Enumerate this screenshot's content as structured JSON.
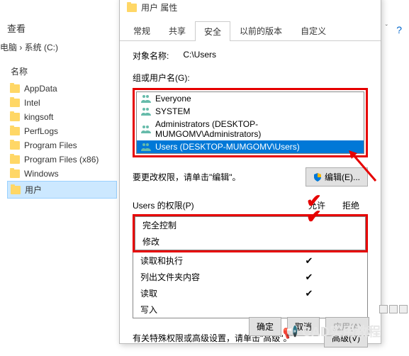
{
  "explorer": {
    "view_label": "查看",
    "breadcrumb": "电脑 › 系统 (C:)",
    "names_header": "名称",
    "folders": [
      "AppData",
      "Intel",
      "kingsoft",
      "PerfLogs",
      "Program Files",
      "Program Files (x86)",
      "Windows",
      "用户"
    ]
  },
  "dialog": {
    "title": "用户 属性",
    "tabs": [
      "常规",
      "共享",
      "安全",
      "以前的版本",
      "自定义"
    ],
    "object_label": "对象名称:",
    "object_value": "C:\\Users",
    "group_label": "组或用户名(G):",
    "groups": [
      {
        "name": "Everyone"
      },
      {
        "name": "SYSTEM"
      },
      {
        "name": "Administrators (DESKTOP-MUMGOMV\\Administrators)"
      },
      {
        "name": "Users (DESKTOP-MUMGOMV\\Users)"
      }
    ],
    "edit_hint": "要更改权限，请单击\"编辑\"。",
    "edit_btn": "编辑(E)...",
    "perm_header": "Users 的权限(P)",
    "allow": "允许",
    "deny": "拒绝",
    "perms": [
      {
        "name": "完全控制",
        "allow": false
      },
      {
        "name": "修改",
        "allow": false
      },
      {
        "name": "读取和执行",
        "allow": true
      },
      {
        "name": "列出文件夹内容",
        "allow": true
      },
      {
        "name": "读取",
        "allow": true
      },
      {
        "name": "写入",
        "allow": false
      }
    ],
    "adv_hint": "有关特殊权限或高级设置，请单击\"高级\"。",
    "adv_btn": "高级(V)",
    "ok": "确定",
    "cancel": "取消",
    "apply": "应用(A)"
  },
  "watermark": "CAD实用教程"
}
